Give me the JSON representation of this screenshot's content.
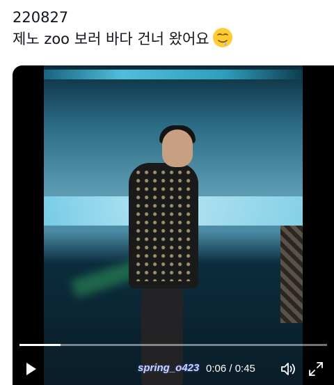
{
  "tweet": {
    "date_line": "220827",
    "text_line": "제노 zoo 보러 바다 건너 왔어요"
  },
  "emoji": {
    "icon": "drooling-face-emoji"
  },
  "video": {
    "watermark": "spring_o423",
    "time_display": "0:06 / 0:45",
    "progress": 0.133,
    "icons": {
      "play": "play-icon",
      "volume": "volume-icon",
      "fullscreen": "fullscreen-icon"
    }
  }
}
